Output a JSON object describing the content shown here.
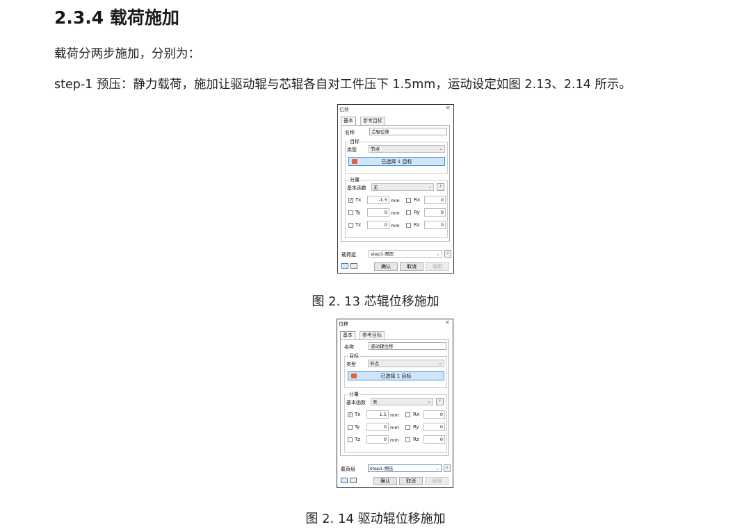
{
  "heading": "2.3.4 载荷施加",
  "para1": "载荷分两步施加，分别为：",
  "para2": "step-1 预压：静力载荷，施加让驱动辊与芯辊各自对工件压下 1.5mm，运动设定如图 2.13、2.14 所示。",
  "figures": [
    {
      "caption": "图 2. 13 芯辊位移施加",
      "dialog": {
        "title": "位移",
        "close": "×",
        "tab_basic": "基本",
        "tab_ref": "参考目标",
        "name_label": "名称",
        "name_value": "芯辊位移",
        "target_group": "目标",
        "type_label": "类型",
        "type_value": "节点",
        "selected": "已选择 1 目标",
        "component_group": "分量",
        "base_func_label": "基本函数",
        "base_func_value": "无",
        "tx_label": "Tx",
        "tx_value": "-1.5",
        "tx_checked": "✓",
        "tx_unit": "mm",
        "ty_label": "Ty",
        "ty_value": "0",
        "ty_unit": "mm",
        "tz_label": "Tz",
        "tz_value": "0",
        "tz_unit": "mm",
        "rx_label": "Rx",
        "rx_value": "0",
        "ry_label": "Ry",
        "ry_value": "0",
        "rz_label": "Rz",
        "rz_value": "0",
        "load_group_label": "载荷组",
        "load_group_value": "step1-预压",
        "ok": "确认",
        "cancel": "取消",
        "apply": "适用"
      }
    },
    {
      "caption": "图 2. 14 驱动辊位移施加",
      "dialog": {
        "title": "位移",
        "close": "×",
        "tab_basic": "基本",
        "tab_ref": "参考目标",
        "name_label": "名称",
        "name_value": "驱动辊位移",
        "target_group": "目标",
        "type_label": "类型",
        "type_value": "节点",
        "selected": "已选择 1 目标",
        "component_group": "分量",
        "base_func_label": "基本函数",
        "base_func_value": "无",
        "tx_label": "Tx",
        "tx_value": "1.5",
        "tx_checked": "✓",
        "tx_unit": "mm",
        "ty_label": "Ty",
        "ty_value": "0",
        "ty_unit": "mm",
        "tz_label": "Tz",
        "tz_value": "0",
        "tz_unit": "mm",
        "rx_label": "Rx",
        "rx_value": "0",
        "ry_label": "Ry",
        "ry_value": "0",
        "rz_label": "Rz",
        "rz_value": "0",
        "load_group_label": "载荷组",
        "load_group_value": "step1-预压",
        "ok": "确认",
        "cancel": "取消",
        "apply": "适用"
      }
    }
  ]
}
